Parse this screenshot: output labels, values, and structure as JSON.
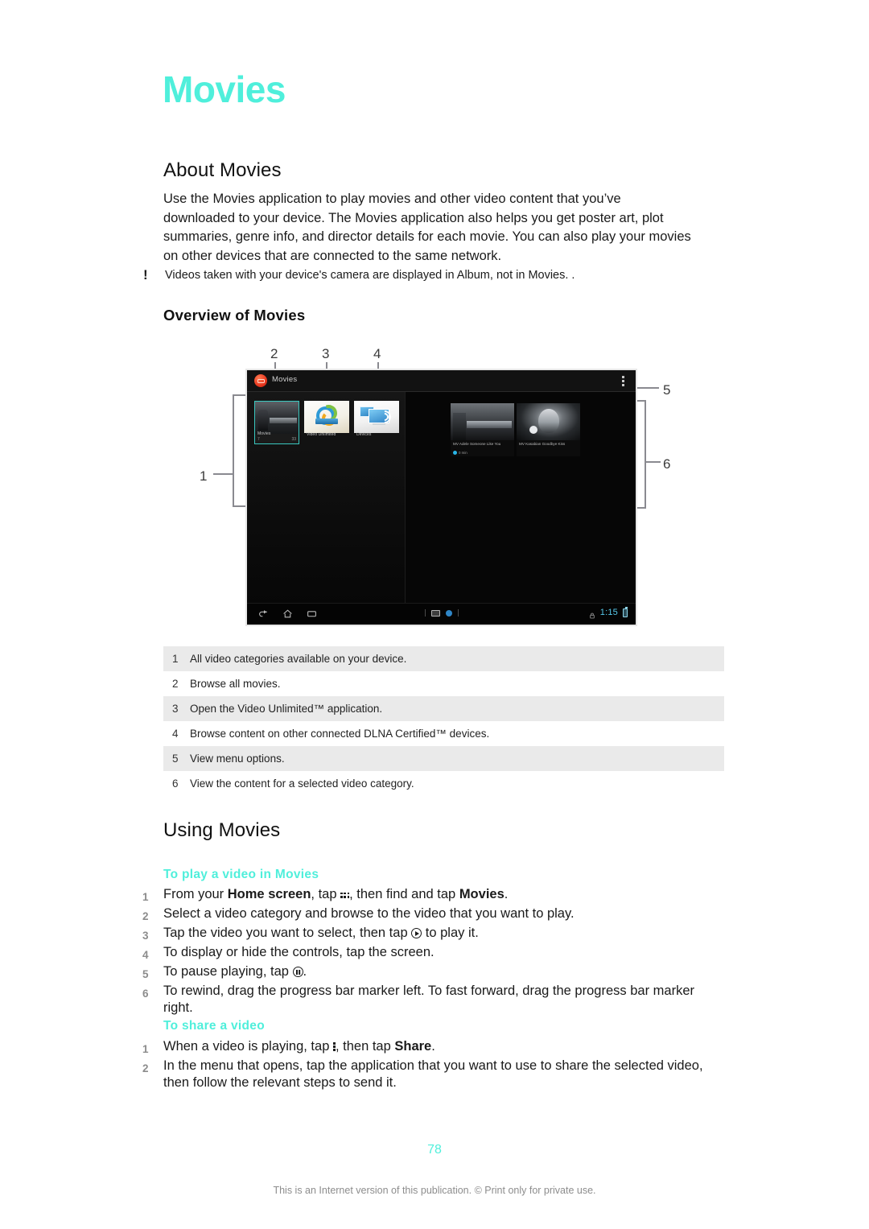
{
  "chapter": {
    "title": "Movies"
  },
  "about": {
    "heading": "About Movies",
    "paragraph": "Use the Movies application to play movies and other video content that you’ve downloaded to your device. The Movies application also helps you get poster art, plot summaries, genre info, and director details for each movie. You can also play your movies on other devices that are connected to the same network."
  },
  "note": {
    "icon": "exclamation-icon",
    "marker": "!",
    "text": "Videos taken with your device's camera are displayed in Album, not in Movies. ."
  },
  "overview": {
    "heading": "Overview of Movies",
    "callouts": [
      "1",
      "2",
      "3",
      "4",
      "5",
      "6"
    ],
    "device": {
      "app_title": "Movies",
      "app_icon": "movies-app-icon",
      "overflow_icon": "overflow-menu-icon",
      "tiles": [
        {
          "label": "Movies",
          "sublabel": "7",
          "corner": "33",
          "icon": "movies-tile-icon"
        },
        {
          "label": "Video Unlimited",
          "corner": "",
          "icon": "video-unlimited-icon"
        },
        {
          "label": "Devices",
          "corner": "",
          "icon": "devices-icon"
        }
      ],
      "videos": [
        {
          "title": "MV Adele Someone Like You",
          "badge": "0 min"
        },
        {
          "title": "MV Kasabian Goodbye Kiss",
          "badge": ""
        }
      ],
      "navbar": {
        "back_icon": "back-icon",
        "home_icon": "home-icon",
        "recents_icon": "recent-apps-icon",
        "screenshot_icon": "screen-capture-icon",
        "browser_icon": "globe-icon",
        "lock_icon": "lock-icon",
        "clock": "1:15",
        "battery_icon": "battery-icon"
      }
    },
    "legend": [
      {
        "num": "1",
        "text": "All video categories available on your device."
      },
      {
        "num": "2",
        "text": "Browse all movies."
      },
      {
        "num": "3",
        "text": "Open the Video Unlimited™ application."
      },
      {
        "num": "4",
        "text": "Browse content on other connected DLNA Certified™ devices."
      },
      {
        "num": "5",
        "text": "View menu options."
      },
      {
        "num": "6",
        "text": "View the content for a selected video category."
      }
    ]
  },
  "using": {
    "heading": "Using Movies",
    "play": {
      "heading": "To play a video in Movies",
      "steps": [
        {
          "num": "1",
          "parts": [
            {
              "t": "From your "
            },
            {
              "t": "Home screen",
              "b": true
            },
            {
              "t": ", tap "
            },
            {
              "icon": "app-drawer-grid-icon"
            },
            {
              "t": ", then find and tap "
            },
            {
              "t": "Movies",
              "b": true
            },
            {
              "t": "."
            }
          ]
        },
        {
          "num": "2",
          "parts": [
            {
              "t": "Select a video category and browse to the video that you want to play."
            }
          ]
        },
        {
          "num": "3",
          "parts": [
            {
              "t": "Tap the video you want to select, then tap "
            },
            {
              "icon": "play-circle-icon"
            },
            {
              "t": " to play it."
            }
          ]
        },
        {
          "num": "4",
          "parts": [
            {
              "t": "To display or hide the controls, tap the screen."
            }
          ]
        },
        {
          "num": "5",
          "parts": [
            {
              "t": "To pause playing, tap "
            },
            {
              "icon": "pause-circle-icon"
            },
            {
              "t": "."
            }
          ]
        },
        {
          "num": "6",
          "parts": [
            {
              "t": "To rewind, drag the progress bar marker left. To fast forward, drag the progress bar marker right."
            }
          ]
        }
      ]
    },
    "share": {
      "heading": "To share a video",
      "steps": [
        {
          "num": "1",
          "parts": [
            {
              "t": "When a video is playing, tap "
            },
            {
              "icon": "overflow-dots-icon"
            },
            {
              "t": ", then tap "
            },
            {
              "t": "Share",
              "b": true
            },
            {
              "t": "."
            }
          ]
        },
        {
          "num": "2",
          "parts": [
            {
              "t": "In the menu that opens, tap the application that you want to use to share the selected video, then follow the relevant steps to send it."
            }
          ]
        }
      ]
    }
  },
  "footer": {
    "page_number": "78",
    "notice": "This is an Internet version of this publication. © Print only for private use."
  },
  "colors": {
    "accent": "#4fefdb",
    "selected_tile_border": "#39c8c0",
    "table_shaded_row": "#eaeaea",
    "clock_blue": "#56c8ea",
    "footer_gray": "#8d8d8d"
  }
}
